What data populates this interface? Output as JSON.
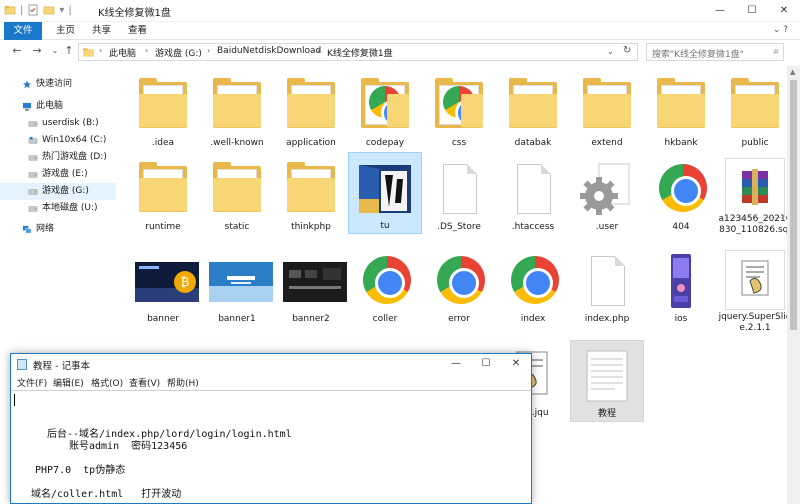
{
  "window": {
    "title": "K线全修复微1盘",
    "controls": {
      "minimize": "—",
      "maximize": "☐",
      "close": "✕"
    }
  },
  "ribbon": {
    "file_tab": "文件",
    "tabs": [
      "主页",
      "共享",
      "查看"
    ],
    "expand": "⌄ ?"
  },
  "nav_buttons": {
    "back": "←",
    "forward": "→",
    "recent": "⌄",
    "up": "↑"
  },
  "address": {
    "crumbs": [
      "此电脑",
      "游戏盘 (G:)",
      "BaiduNetdiskDownload",
      "K线全修复微1盘"
    ],
    "dropdown": "⌄",
    "refresh": "↻"
  },
  "search": {
    "placeholder": "搜索\"K线全修复微1盘\""
  },
  "sidebar": {
    "items": [
      {
        "label": "快速访问",
        "icon": "star-icon"
      },
      {
        "label": "此电脑",
        "icon": "computer-icon"
      },
      {
        "label": "userdisk (B:)",
        "icon": "drive-icon"
      },
      {
        "label": "Win10x64 (C:)",
        "icon": "system-drive-icon"
      },
      {
        "label": "热门游戏盘 (D:)",
        "icon": "drive-icon"
      },
      {
        "label": "游戏盘 (E:)",
        "icon": "drive-icon"
      },
      {
        "label": "游戏盘 (G:)",
        "icon": "drive-icon",
        "selected": true
      },
      {
        "label": "本地磁盘 (U:)",
        "icon": "drive-icon"
      },
      {
        "label": "网络",
        "icon": "network-icon"
      }
    ]
  },
  "files": [
    {
      "name": ".idea",
      "type": "folder"
    },
    {
      "name": ".well-known",
      "type": "folder"
    },
    {
      "name": "application",
      "type": "folder"
    },
    {
      "name": "codepay",
      "type": "folder-chrome"
    },
    {
      "name": "css",
      "type": "folder-chrome"
    },
    {
      "name": "databak",
      "type": "folder"
    },
    {
      "name": "extend",
      "type": "folder"
    },
    {
      "name": "hkbank",
      "type": "folder"
    },
    {
      "name": "public",
      "type": "folder"
    },
    {
      "name": "runtime",
      "type": "folder"
    },
    {
      "name": "static",
      "type": "folder"
    },
    {
      "name": "thinkphp",
      "type": "folder"
    },
    {
      "name": "tu",
      "type": "folder-image",
      "selected": true
    },
    {
      "name": ".DS_Store",
      "type": "blank"
    },
    {
      "name": ".htaccess",
      "type": "blank"
    },
    {
      "name": ".user",
      "type": "gear"
    },
    {
      "name": "404",
      "type": "chrome"
    },
    {
      "name": "a123456_20210830_110826.sql",
      "type": "winrar"
    },
    {
      "name": "banner",
      "type": "image-bitcoin"
    },
    {
      "name": "banner1",
      "type": "image-azure"
    },
    {
      "name": "banner2",
      "type": "image-dark"
    },
    {
      "name": "coller",
      "type": "chrome"
    },
    {
      "name": "error",
      "type": "chrome"
    },
    {
      "name": "index",
      "type": "chrome"
    },
    {
      "name": "index.php",
      "type": "blank"
    },
    {
      "name": "ios",
      "type": "image-phone"
    },
    {
      "name": "jquery.SuperSlide.2.1.1",
      "type": "script"
    },
    {
      "name": "4.2.jqu",
      "type": "script"
    },
    {
      "name": "教程",
      "type": "text",
      "selected": true
    }
  ],
  "notepad": {
    "title": "教程 - 记事本",
    "menu": [
      "文件(F)",
      "编辑(E)",
      "格式(O)",
      "查看(V)",
      "帮助(H)"
    ],
    "lines": [
      "后台--域名/index.php/lord/login/login.html",
      "账号admin  密码123456",
      "PHP7.0  tp伪静态",
      "域名/coller.html   打开波动"
    ]
  },
  "colors": {
    "accent": "#1979ca",
    "selection": "#cce8ff",
    "folder": "#f8d675"
  }
}
